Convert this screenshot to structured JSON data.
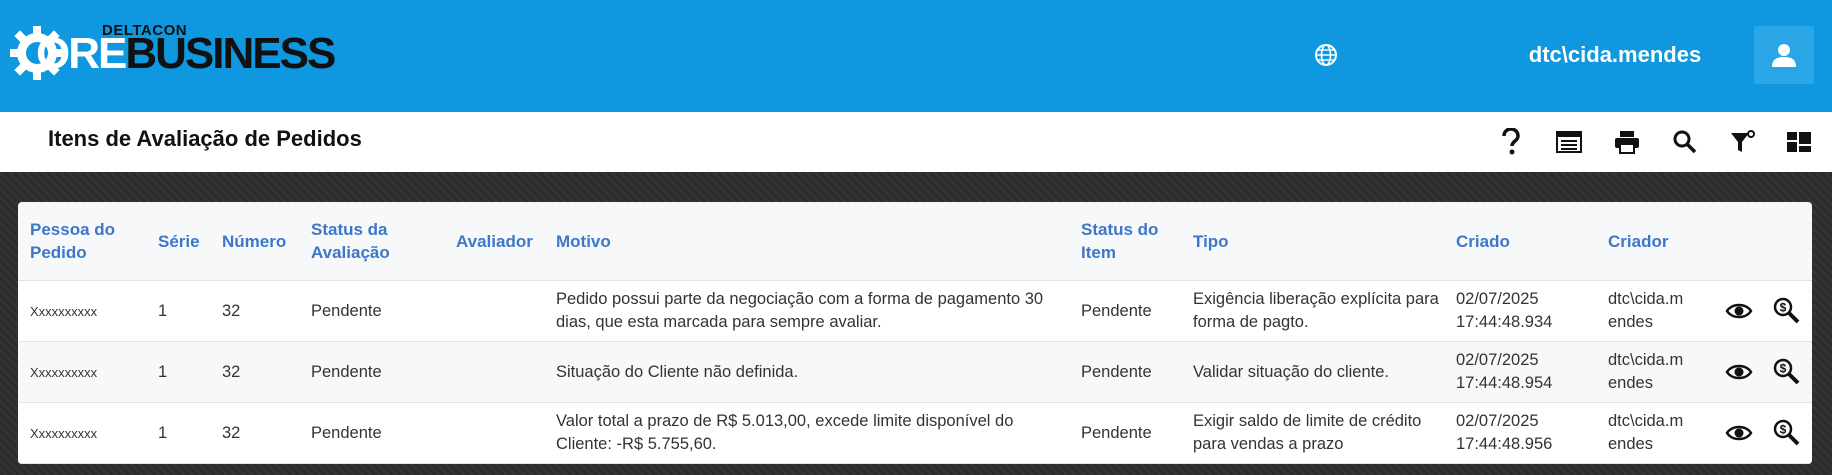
{
  "brand": {
    "small": "DELTACON",
    "large_white": "ORE",
    "large_dark": "BUSINESS"
  },
  "topbar": {
    "language_icon": "globe-icon",
    "username": "dtc\\cida.mendes",
    "user_icon": "user-icon",
    "color": "#0f98e0"
  },
  "page": {
    "title": "Itens de Avaliação de Pedidos",
    "toolbar": [
      {
        "name": "help-icon"
      },
      {
        "name": "list-view-icon"
      },
      {
        "name": "print-icon"
      },
      {
        "name": "search-icon"
      },
      {
        "name": "filter-icon"
      },
      {
        "name": "layout-icon"
      }
    ]
  },
  "table": {
    "header_color": "#3d78c8",
    "columns": [
      "Pessoa do Pedido",
      "Série",
      "Número",
      "Status da Avaliação",
      "Avaliador",
      "Motivo",
      "Status do Item",
      "Tipo",
      "Criado",
      "Criador",
      ""
    ],
    "rows": [
      {
        "pessoa": "Xxxxxxxxxx",
        "serie": "1",
        "numero": "32",
        "status_avaliacao": "Pendente",
        "avaliador": "",
        "motivo": "Pedido possui parte da negociação com a forma de pagamento 30 dias, que esta marcada para sempre avaliar.",
        "status_item": "Pendente",
        "tipo": "Exigência liberação explícita para forma de pagto.",
        "criado": "02/07/2025 17:44:48.934",
        "criador": "dtc\\cida.mendes"
      },
      {
        "pessoa": "Xxxxxxxxxx",
        "serie": "1",
        "numero": "32",
        "status_avaliacao": "Pendente",
        "avaliador": "",
        "motivo": "Situação do Cliente não definida.",
        "status_item": "Pendente",
        "tipo": "Validar situação do cliente.",
        "criado": "02/07/2025 17:44:48.954",
        "criador": "dtc\\cida.mendes"
      },
      {
        "pessoa": "Xxxxxxxxxx",
        "serie": "1",
        "numero": "32",
        "status_avaliacao": "Pendente",
        "avaliador": "",
        "motivo": "Valor total a prazo de R$ 5.013,00, excede limite disponível do Cliente: -R$ 5.755,60.",
        "status_item": "Pendente",
        "tipo": "Exigir saldo de limite de crédito para vendas a prazo",
        "criado": "02/07/2025 17:44:48.956",
        "criador": "dtc\\cida.mendes"
      }
    ],
    "row_actions": [
      "eye-icon",
      "financial-search-icon"
    ]
  }
}
